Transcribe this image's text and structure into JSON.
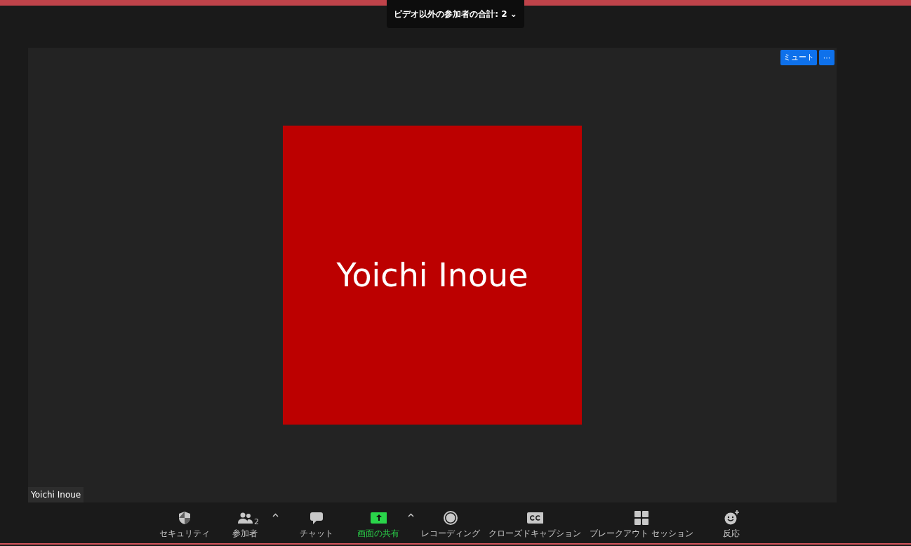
{
  "header": {
    "label": "ビデオ以外の参加者の合計: 2",
    "caret": "⌄"
  },
  "video": {
    "avatar_name": "Yoichi Inoue",
    "name_tag": "Yoichi Inoue",
    "mute_button": "ミュート",
    "more_button": "···"
  },
  "toolbar": [
    {
      "kind": "security",
      "label": "セキュリティ",
      "menu": false,
      "active": false
    },
    {
      "kind": "participants",
      "label": "参加者",
      "count": "2",
      "menu": true,
      "active": false
    },
    {
      "kind": "chat",
      "label": "チャット",
      "menu": false,
      "active": false
    },
    {
      "kind": "share",
      "label": "画面の共有",
      "menu": true,
      "active": true
    },
    {
      "kind": "record",
      "label": "レコーディング",
      "menu": false,
      "active": false
    },
    {
      "kind": "captions",
      "label": "クローズドキャプション",
      "menu": false,
      "active": false
    },
    {
      "kind": "breakout",
      "label": "ブレークアウト セッション",
      "menu": false,
      "active": false
    },
    {
      "kind": "reactions",
      "label": "反応",
      "menu": false,
      "active": false
    }
  ]
}
